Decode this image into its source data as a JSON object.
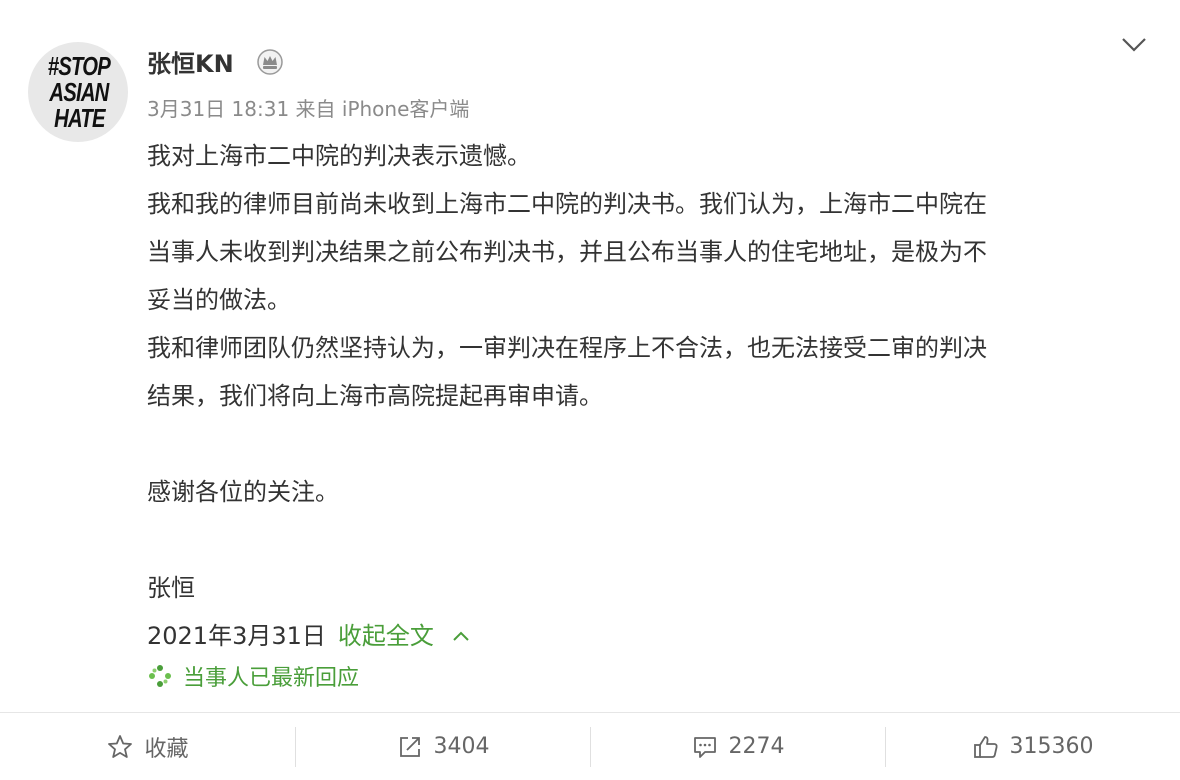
{
  "avatar": {
    "lines": [
      "#STOP",
      "ASIAN",
      "HATE"
    ]
  },
  "author": {
    "name": "张恒KN"
  },
  "post": {
    "meta": "3月31日 18:31 来自 iPhone客户端",
    "lines": [
      "我对上海市二中院的判决表示遗憾。",
      "我和我的律师目前尚未收到上海市二中院的判决书。我们认为，上海市二中院在",
      "当事人未收到判决结果之前公布判决书，并且公布当事人的住宅地址，是极为不",
      "妥当的做法。",
      "我和律师团队仍然坚持认为，一审判决在程序上不合法，也无法接受二审的判决",
      "结果，我们将向上海市高院提起再审申请。"
    ],
    "thanks": "感谢各位的关注。",
    "signature": "张恒",
    "date": "2021年3月31日",
    "collapse_label": "收起全文"
  },
  "response_label": "当事人已最新回应",
  "actions": {
    "favorite": "收藏",
    "repost": "3404",
    "comment": "2274",
    "like": "315360"
  },
  "colors": {
    "link_green": "#4a9e3a",
    "text": "#333333",
    "meta": "#8a8a8a"
  }
}
